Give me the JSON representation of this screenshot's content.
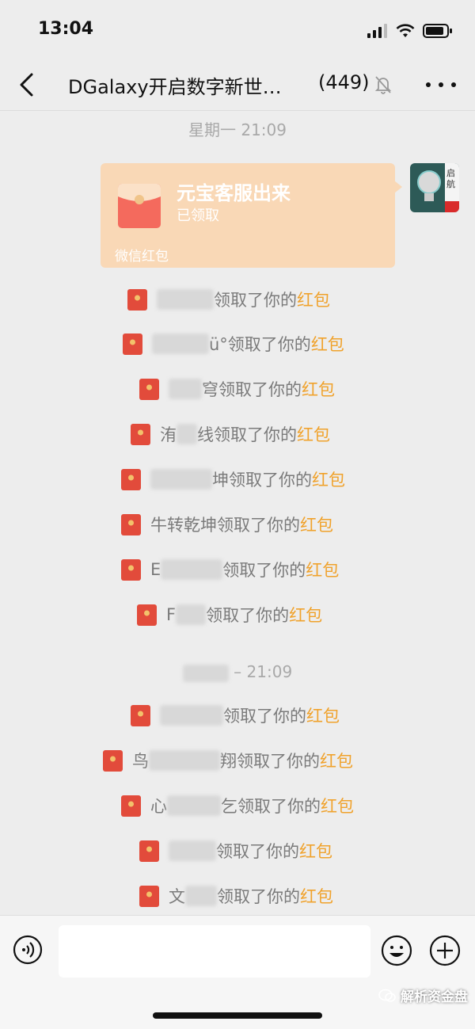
{
  "status_bar": {
    "time": "13:04"
  },
  "nav": {
    "title": "DGalaxy开启数字新世…",
    "member_count": "(449)"
  },
  "timestamps": [
    "星期一 21:09",
    "– 21:09"
  ],
  "red_packet": {
    "title": "元宝客服出来",
    "status": "已领取",
    "footer": "微信红包"
  },
  "notices": [
    {
      "prefix": "",
      "suffix": "领取了你的",
      "highlight": "红包"
    },
    {
      "prefix": "",
      "suffix": "ü°领取了你的",
      "highlight": "红包"
    },
    {
      "prefix": "",
      "suffix": "穹领取了你的",
      "highlight": "红包"
    },
    {
      "prefix": "洧",
      "suffix": "线领取了你的",
      "highlight": "红包"
    },
    {
      "prefix": "",
      "suffix": "坤领取了你的",
      "highlight": "红包"
    },
    {
      "prefix": "牛转乾坤",
      "suffix": "领取了你的",
      "highlight": "红包"
    },
    {
      "prefix": "E",
      "suffix": "领取了你的",
      "highlight": "红包"
    },
    {
      "prefix": "F",
      "suffix": "领取了你的",
      "highlight": "红包"
    },
    {
      "prefix": "",
      "suffix": "领取了你的",
      "highlight": "红包"
    },
    {
      "prefix": "鸟",
      "suffix": "翔领取了你的",
      "highlight": "红包"
    },
    {
      "prefix": "心",
      "suffix": "乞领取了你的",
      "highlight": "红包"
    },
    {
      "prefix": "",
      "suffix": "领取了你的",
      "highlight": "红包"
    },
    {
      "prefix": "文",
      "suffix": "领取了你的",
      "highlight": "红包"
    }
  ],
  "input_bar": {
    "placeholder": ""
  },
  "watermark": "解析资金盘",
  "avatar_text": "启航",
  "colors": {
    "background": "#ededed",
    "packet": "#f9d8b6",
    "envelope_red": "#e24b3b",
    "highlight": "#f0a22c"
  },
  "icons": [
    "back-icon",
    "mute-icon",
    "more-icon",
    "voice-icon",
    "emoji-icon",
    "plus-icon",
    "envelope-icon",
    "wechat-icon"
  ]
}
